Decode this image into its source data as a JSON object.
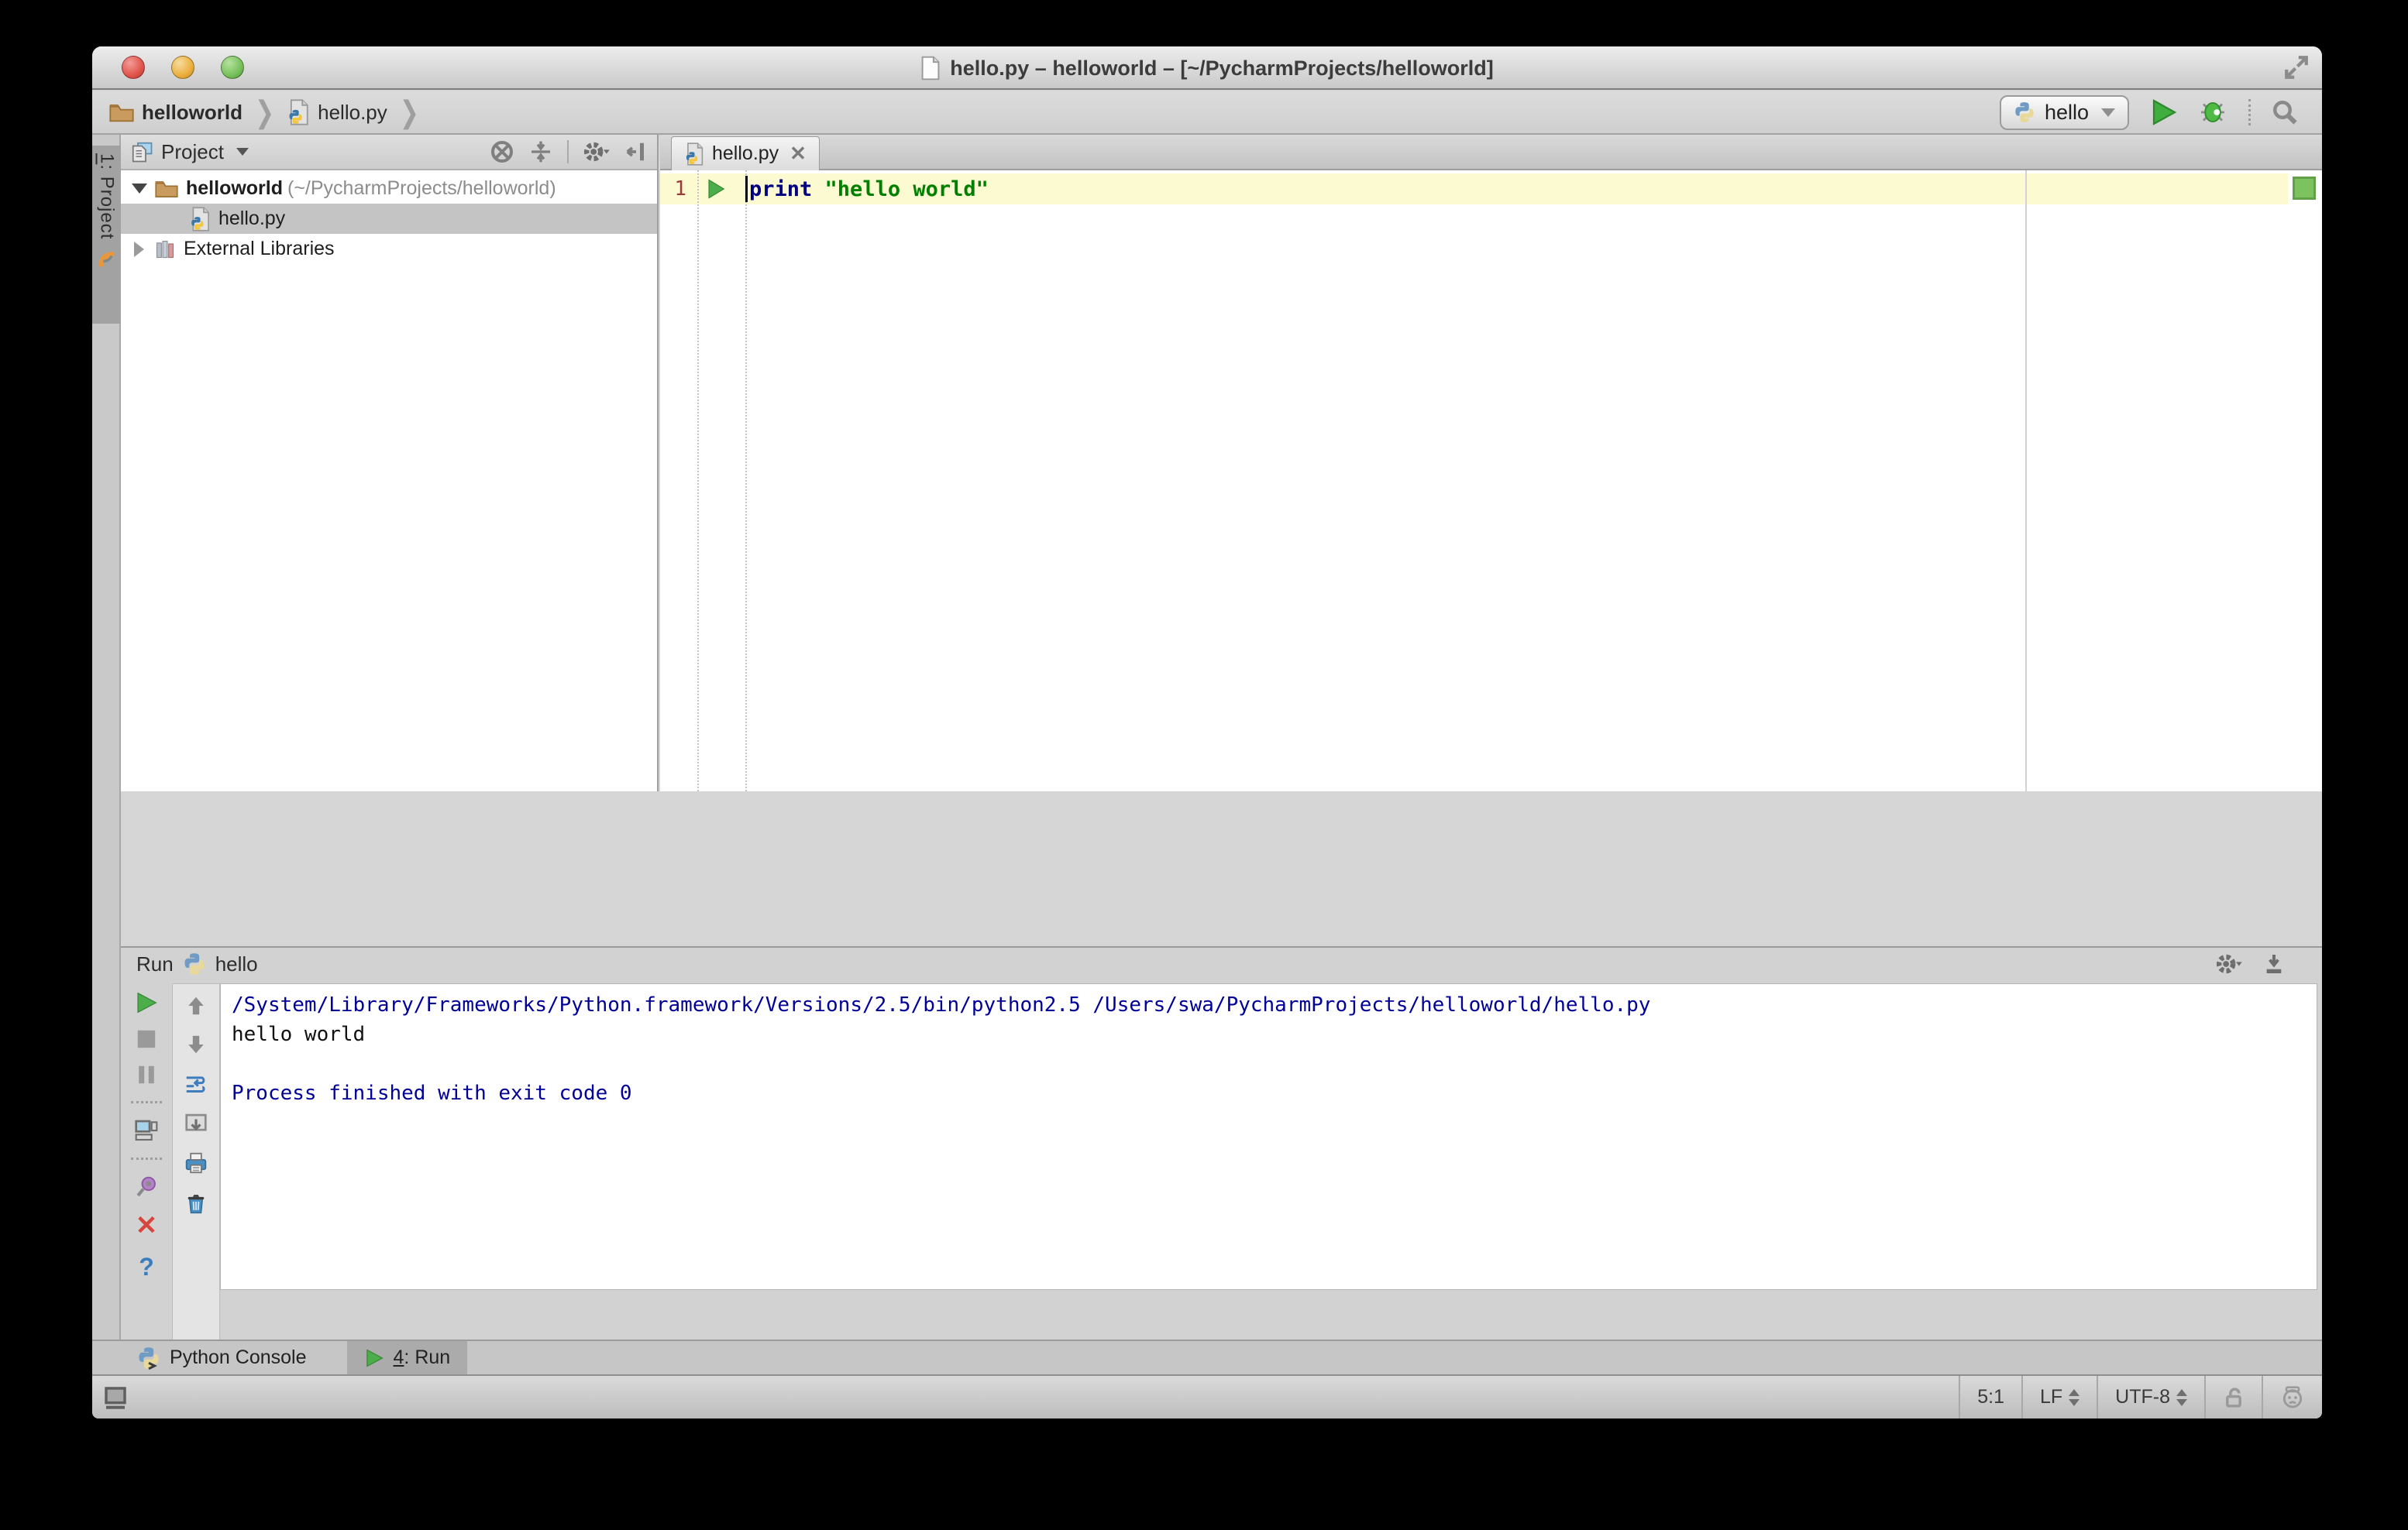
{
  "window": {
    "title": "hello.py – helloworld – [~/PycharmProjects/helloworld]"
  },
  "breadcrumb": {
    "project": "helloworld",
    "file": "hello.py"
  },
  "run_widget": {
    "config_name": "hello"
  },
  "tool_strip": {
    "project_tab_mnemonic": "1",
    "project_tab_label": ": Project"
  },
  "project_panel": {
    "title": "Project",
    "tree": {
      "root_name": "helloworld",
      "root_path": "(~/PycharmProjects/helloworld)",
      "file": "hello.py",
      "external_libraries": "External Libraries"
    }
  },
  "editor": {
    "tab_label": "hello.py",
    "line_number": "1",
    "code": {
      "keyword": "print",
      "string": "\"hello world\""
    }
  },
  "run_panel": {
    "label": "Run",
    "config_name": "hello",
    "console": {
      "lines": [
        "/System/Library/Frameworks/Python.framework/Versions/2.5/bin/python2.5 /Users/swa/PycharmProjects/helloworld/hello.py",
        "hello world",
        "",
        "Process finished with exit code 0"
      ]
    }
  },
  "tool_tabs": {
    "python_console": "Python Console",
    "run_mnemonic": "4",
    "run_label": ": Run"
  },
  "status_bar": {
    "caret_position": "5:1",
    "line_separator": "LF",
    "encoding": "UTF-8"
  },
  "colors": {
    "keyword": "#000080",
    "string": "#008000",
    "console_info": "#000099",
    "current_line": "#fbfad0",
    "run_green": "#3fa142",
    "selection_gray": "#c4c4c4"
  }
}
